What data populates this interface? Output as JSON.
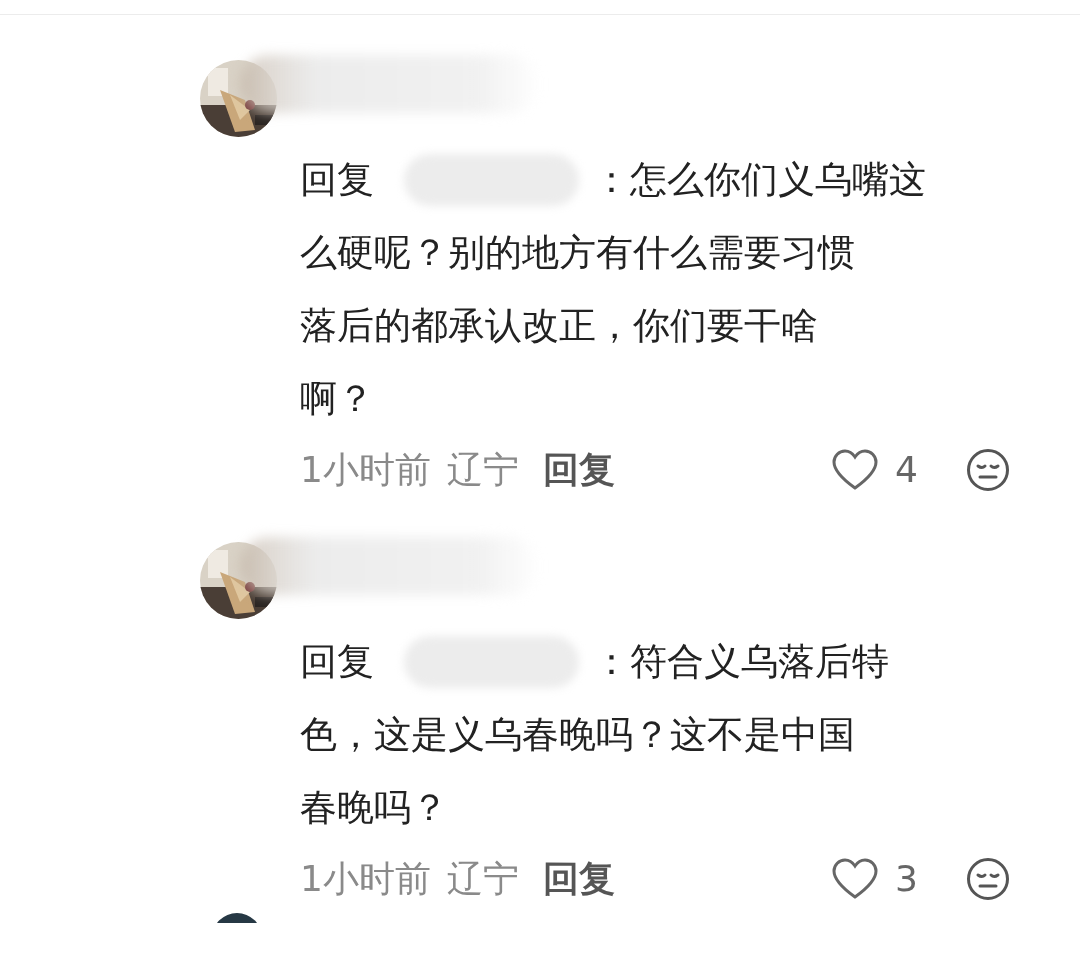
{
  "comments": [
    {
      "reply_label": "回复",
      "text_lines": [
        "：怎么你们义乌嘴这",
        "么硬呢？别的地方有什么需要习惯",
        "落后的都承认改正，你们要干啥",
        "啊？"
      ],
      "time": "1小时前",
      "location": "辽宁",
      "reply_button": "回复",
      "likes": "4",
      "liked": false
    },
    {
      "reply_label": "回复",
      "text_lines": [
        "：符合义乌落后特",
        "色，这是义乌春晚吗？这不是中国",
        "春晚吗？"
      ],
      "time": "1小时前",
      "location": "辽宁",
      "reply_button": "回复",
      "likes": "3",
      "liked": false
    }
  ]
}
